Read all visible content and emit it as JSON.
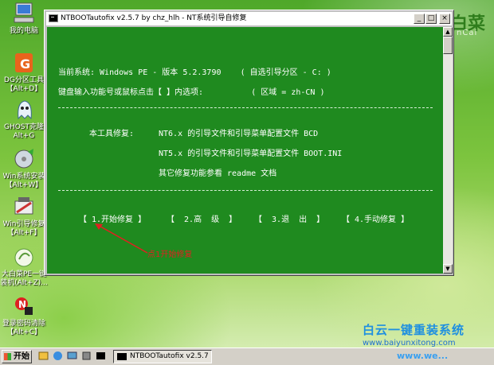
{
  "desktop": {
    "icons": [
      {
        "label1": "我的电脑",
        "label2": ""
      },
      {
        "label1": "DG分区工具",
        "label2": "【Alt+D】"
      },
      {
        "label1": "GHOST克隆",
        "label2": "Alt+G"
      },
      {
        "label1": "Win系统安装",
        "label2": "【Alt+W】"
      },
      {
        "label1": "Win引导修复",
        "label2": "【Alt+F】"
      },
      {
        "label1": "大白菜PE一键",
        "label2": "装机(Alt+Z)..."
      },
      {
        "label1": "登录密码清除",
        "label2": "【Alt+C】"
      }
    ],
    "brand_big": "白菜",
    "brand_small": "nCai"
  },
  "window": {
    "title": "NTBOOTautofix v2.5.7 by chz_hlh - NT系统引导自修复",
    "btn_min": "_",
    "btn_max": "□",
    "btn_close": "×",
    "line1": "当前系统: Windows PE - 版本 5.2.3790    ( 自选引导分区 - C: )",
    "line2": "键盘输入功能号或鼠标点击【 】内选项:          ( 区域 = zh-CN )",
    "fix_intro": "本工具修复:",
    "fix_nt6": "NT6.x 的引导文件和引导菜单配置文件 BCD",
    "fix_nt5": "NT5.x 的引导文件和引导菜单配置文件 BOOT.INI",
    "fix_other": "其它修复功能参看 readme 文档",
    "menu": [
      "【 1.开始修复 】",
      "【  2.高  级  】",
      "【  3.退  出  】",
      "【 4.手动修复 】"
    ],
    "annotation": "点1开始修复"
  },
  "taskbar": {
    "start_label": "开始",
    "task_label": "NTBOOTautofix v2.5.7 b..."
  },
  "watermark": {
    "line1": "白云一键重装系统",
    "line2": "www.baiyunxitong.com",
    "line3": "www.we..."
  }
}
